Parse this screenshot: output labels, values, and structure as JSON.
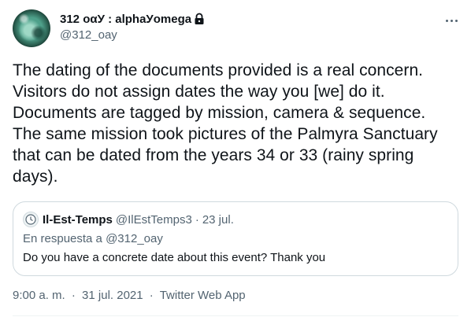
{
  "author": {
    "display_name": "312 οαУ : alphaУomega",
    "handle": "@312_oay",
    "protected": true
  },
  "more_icon": "more-horizontal-icon",
  "tweet": {
    "text": "The dating of the documents provided is a real concern. Visitors do not assign dates the way you [we] do it. Documents are tagged by mission, camera & sequence. The same mission took pictures of the Palmyra Sanctuary that can be dated from the years 34 or 33 (rainy spring days)."
  },
  "quoted_tweet": {
    "display_name": "Il-Est-Temps",
    "handle": "@IlEstTemps3",
    "separator": "·",
    "date": "23 jul.",
    "reply_label": "En respuesta a",
    "reply_to": "@312_oay",
    "text": "Do you have a concrete date about this event? Thank you"
  },
  "meta": {
    "time": "9:00 a. m.",
    "separator": "·",
    "date": "31 jul. 2021",
    "source": "Twitter Web App"
  },
  "colors": {
    "text_primary": "#0f1419",
    "text_secondary": "#536471",
    "border": "#cfd9de"
  }
}
